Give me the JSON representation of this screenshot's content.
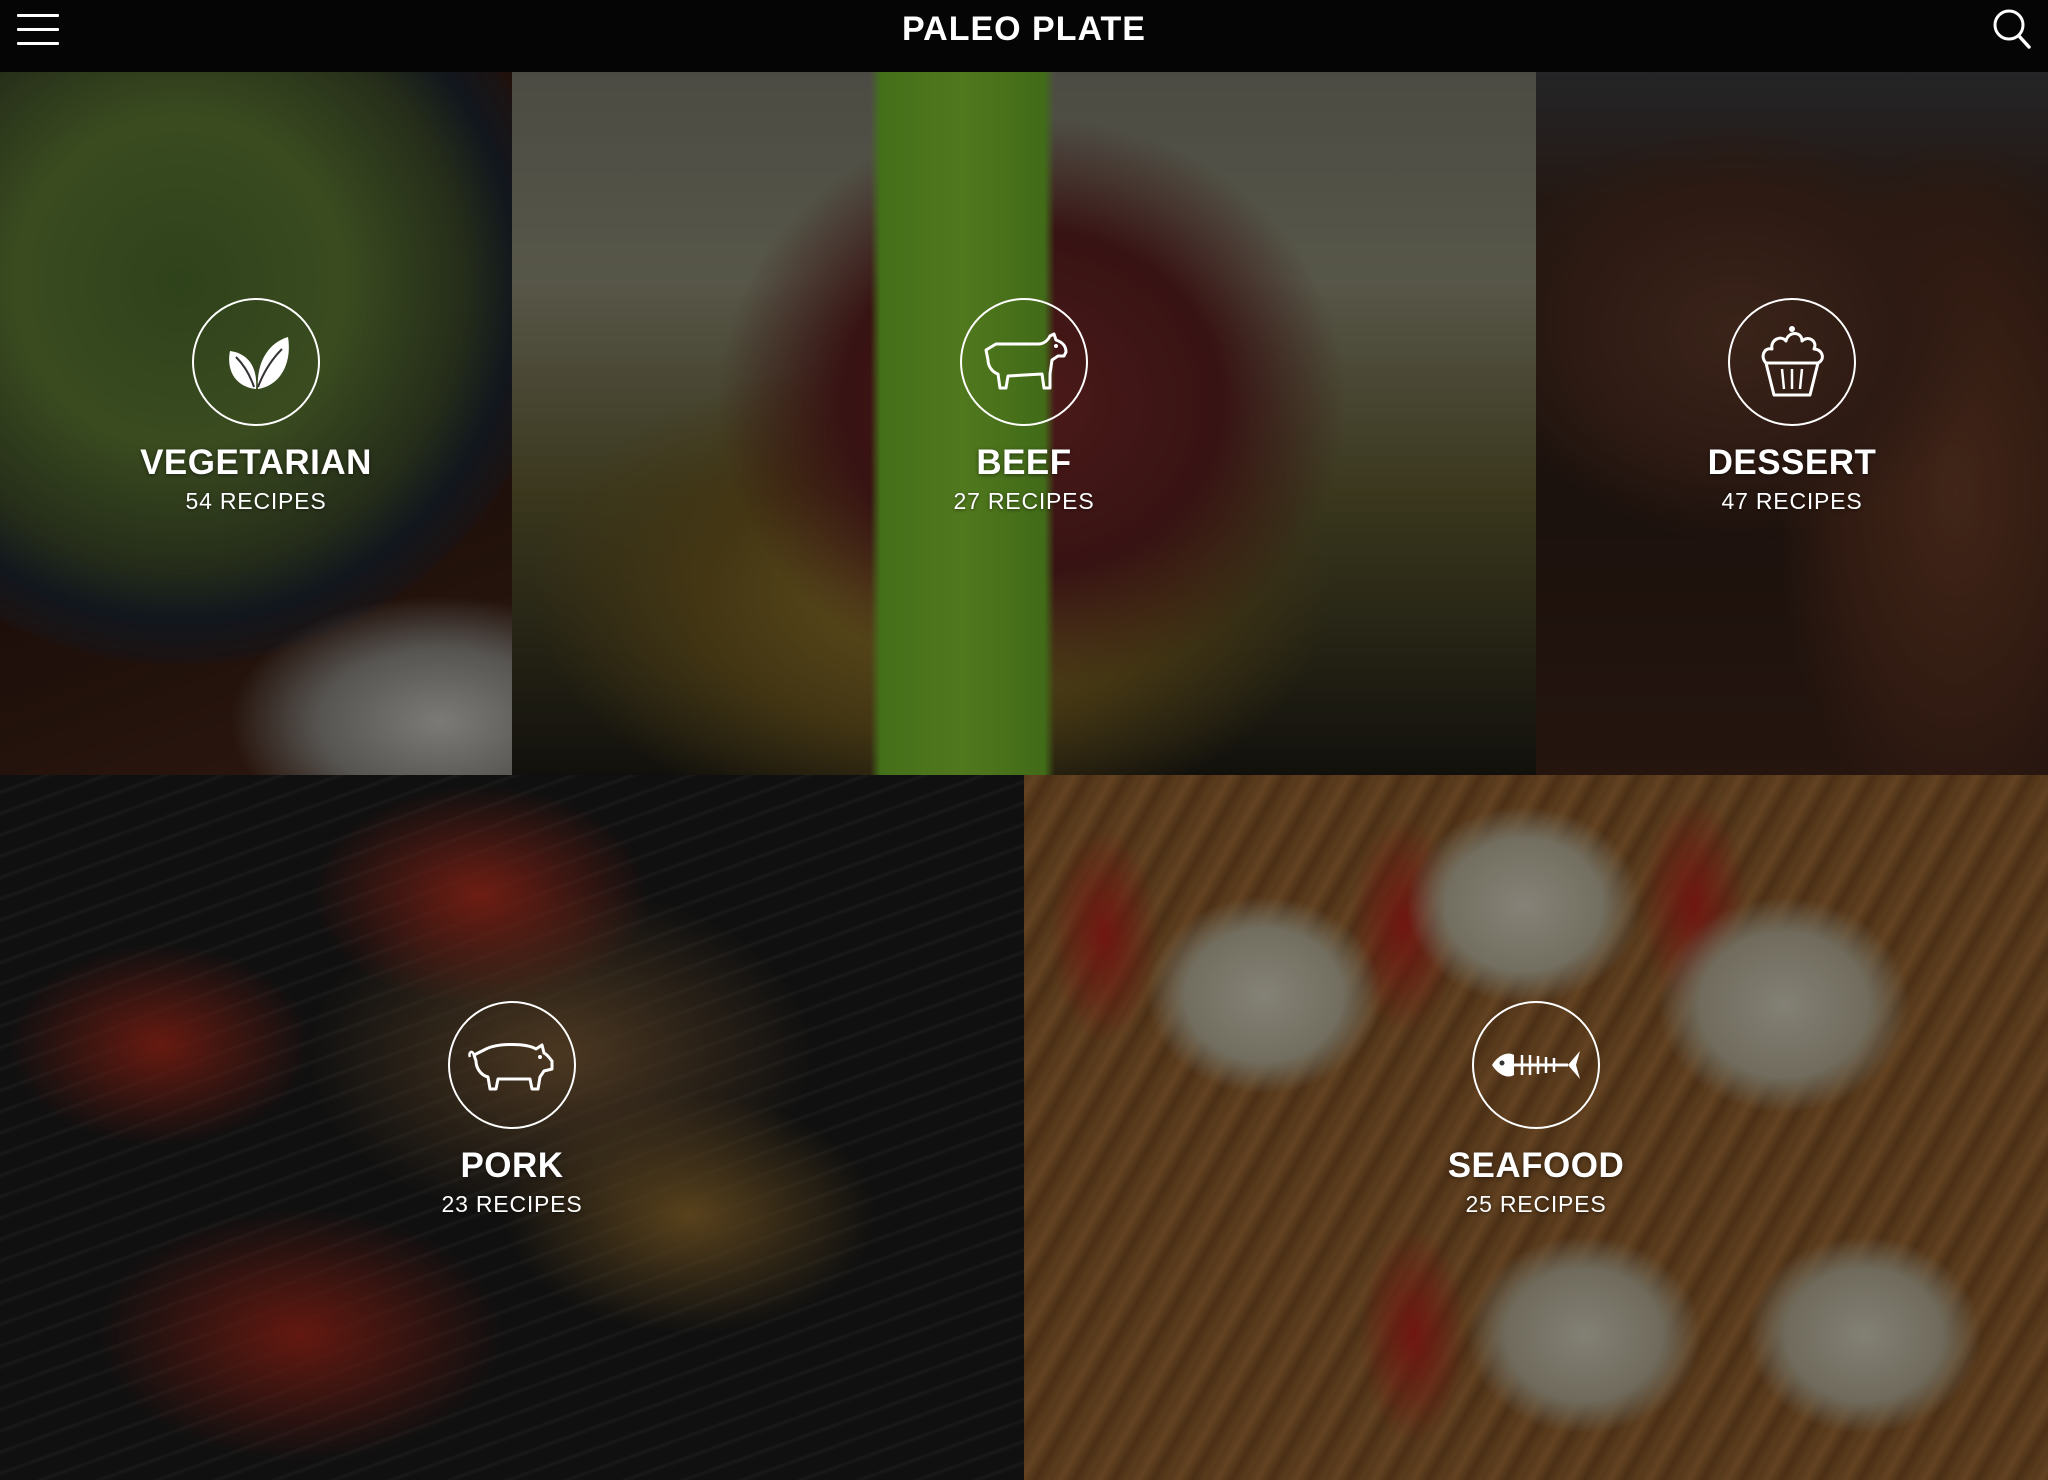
{
  "app": {
    "title": "PALEO PLATE"
  },
  "header": {
    "menu_icon": "hamburger-menu-icon",
    "search_icon": "search-icon"
  },
  "categories": [
    {
      "name": "VEGETARIAN",
      "count": "54 RECIPES",
      "icon": "leaf-icon"
    },
    {
      "name": "BEEF",
      "count": "27 RECIPES",
      "icon": "cow-icon"
    },
    {
      "name": "DESSERT",
      "count": "47 RECIPES",
      "icon": "cupcake-icon"
    },
    {
      "name": "PORK",
      "count": "23 RECIPES",
      "icon": "pig-icon"
    },
    {
      "name": "SEAFOOD",
      "count": "25 RECIPES",
      "icon": "fish-bone-icon"
    }
  ],
  "colors": {
    "topbar": "#050505",
    "text": "#ffffff"
  }
}
